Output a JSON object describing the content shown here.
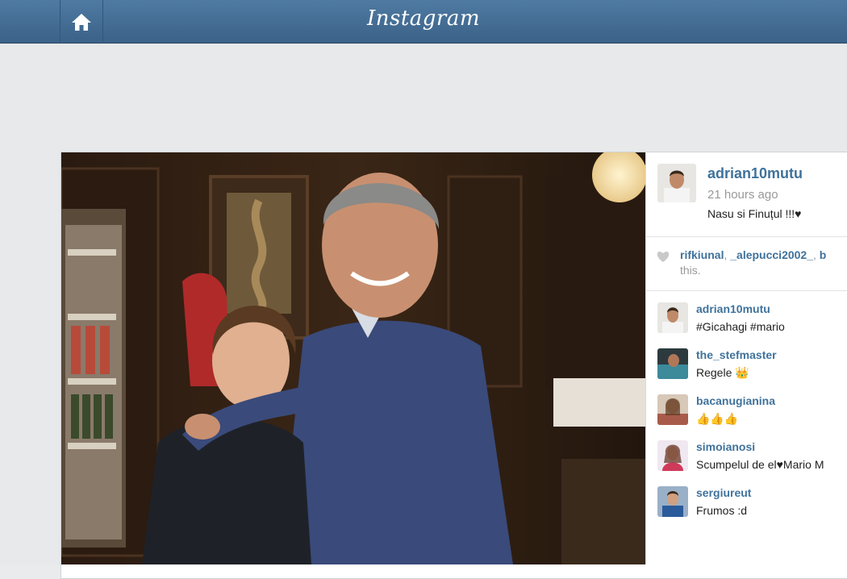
{
  "header": {
    "app_title": "Instagram",
    "home_icon": "home-icon"
  },
  "post": {
    "owner": {
      "username": "adrian10mutu",
      "time_ago": "21 hours ago",
      "caption": "Nasu si Finuțul !!!♥"
    },
    "likes": {
      "heart_icon": "heart-icon",
      "users": [
        "rifkiunal",
        "_alepucci2002_",
        "b"
      ],
      "separator": ", ",
      "suffix": "this."
    },
    "comments": [
      {
        "username": "adrian10mutu",
        "text": "#Gicahagi #mario"
      },
      {
        "username": "the_stefmaster",
        "text": "Regele 👑"
      },
      {
        "username": "bacanugianina",
        "text": "👍👍👍"
      },
      {
        "username": "simoianosi",
        "text": "Scumpelul de el♥Mario M"
      },
      {
        "username": "sergiureut",
        "text": "Frumos :d"
      }
    ]
  },
  "colors": {
    "topbar": "#4f7aa2",
    "username": "#3f729b",
    "muted": "#999999"
  }
}
